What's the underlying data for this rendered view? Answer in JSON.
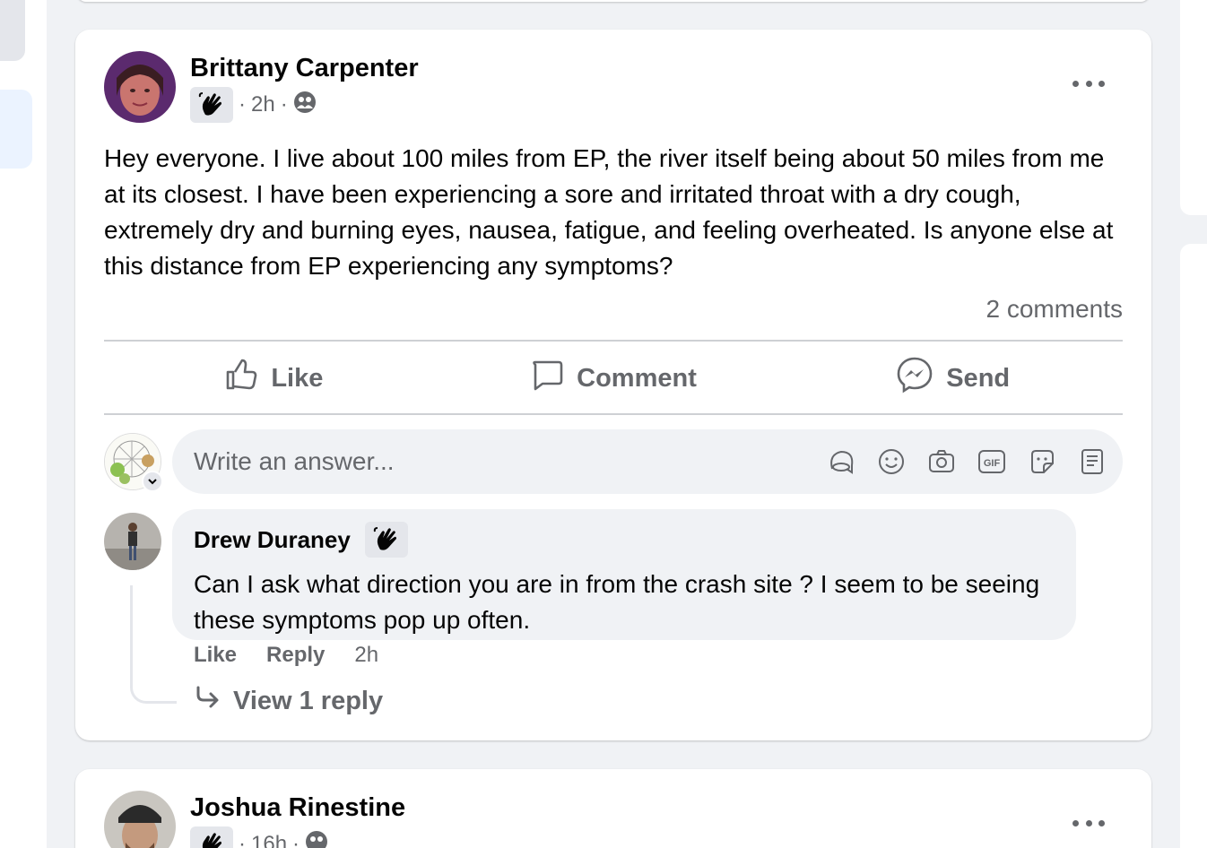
{
  "posts": [
    {
      "author": "Brittany Carpenter",
      "time": "2h",
      "separator": "·",
      "body": "Hey everyone. I live about 100 miles from EP, the river itself being about 50 miles from me at its closest. I have been experiencing a sore and irritated throat with a dry cough, extremely dry and burning eyes, nausea, fatigue, and feeling overheated. Is anyone else at this distance from EP experiencing any symptoms?",
      "comment_count": "2 comments",
      "actions": {
        "like": "Like",
        "comment": "Comment",
        "send": "Send"
      },
      "composer": {
        "placeholder": "Write an answer..."
      },
      "comments": [
        {
          "author": "Drew Duraney",
          "text": "Can I ask what direction you are in from the crash site ? I seem to be seeing these symptoms pop up often.",
          "like": "Like",
          "reply": "Reply",
          "time": "2h",
          "view_replies": "View 1 reply"
        }
      ]
    },
    {
      "author": "Joshua Rinestine",
      "time": "16h",
      "separator": "·"
    }
  ],
  "icons": {
    "member_badge": "wave-hand-icon",
    "audience": "group-members-icon",
    "more": "more-options-icon",
    "like": "thumbs-up-icon",
    "comment": "speech-bubble-icon",
    "send": "messenger-icon",
    "composer": [
      "avatar-sticker-icon",
      "emoji-icon",
      "camera-icon",
      "gif-icon",
      "sticker-icon",
      "clipboard-icon"
    ],
    "reply_arrow": "reply-arrow-icon"
  },
  "colors": {
    "background": "#f0f2f5",
    "card": "#ffffff",
    "secondary_text": "#65676b",
    "primary_text": "#050505"
  }
}
